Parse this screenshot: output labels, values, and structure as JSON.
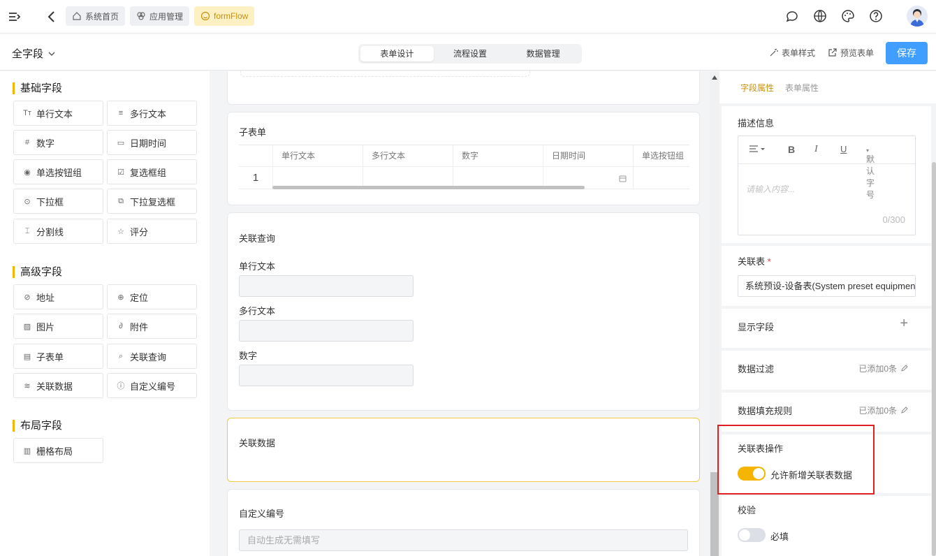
{
  "topbar": {
    "tabs": [
      {
        "label": "系统首页",
        "icon": "home-icon"
      },
      {
        "label": "应用管理",
        "icon": "apps-icon"
      },
      {
        "label": "formFlow",
        "icon": "smile-icon"
      }
    ],
    "icons": [
      "chat-icon",
      "globe-icon",
      "palette-icon",
      "help-icon"
    ]
  },
  "subbar": {
    "form_name": "全字段",
    "segments": [
      "表单设计",
      "流程设置",
      "数据管理"
    ],
    "active_segment": "表单设计",
    "form_style": "表单样式",
    "preview": "预览表单",
    "save": "保存"
  },
  "left": {
    "groups": [
      {
        "title": "基础字段",
        "items": [
          {
            "label": "单行文本",
            "icon": "Tт"
          },
          {
            "label": "多行文本",
            "icon": "≡"
          },
          {
            "label": "数字",
            "icon": "#"
          },
          {
            "label": "日期时间",
            "icon": "▭"
          },
          {
            "label": "单选按钮组",
            "icon": "◉"
          },
          {
            "label": "复选框组",
            "icon": "☑"
          },
          {
            "label": "下拉框",
            "icon": "⊙"
          },
          {
            "label": "下拉复选框",
            "icon": "⧉"
          },
          {
            "label": "分割线",
            "icon": "⌶"
          },
          {
            "label": "评分",
            "icon": "☆"
          }
        ]
      },
      {
        "title": "高级字段",
        "items": [
          {
            "label": "地址",
            "icon": "⊘"
          },
          {
            "label": "定位",
            "icon": "⊕"
          },
          {
            "label": "图片",
            "icon": "▨"
          },
          {
            "label": "附件",
            "icon": "∂"
          },
          {
            "label": "子表单",
            "icon": "▤"
          },
          {
            "label": "关联查询",
            "icon": "⌕"
          },
          {
            "label": "关联数据",
            "icon": "≋"
          },
          {
            "label": "自定义编号",
            "icon": "ⓘ"
          }
        ]
      },
      {
        "title": "布局字段",
        "items": [
          {
            "label": "栅格布局",
            "icon": "▥"
          }
        ]
      }
    ]
  },
  "canvas": {
    "subform": {
      "title": "子表单",
      "columns": [
        "单行文本",
        "多行文本",
        "数字",
        "日期时间",
        "单选按钮组"
      ],
      "row_number": "1"
    },
    "lookup": {
      "title": "关联查询",
      "fields": [
        "单行文本",
        "多行文本",
        "数字"
      ]
    },
    "related_data": {
      "title": "关联数据"
    },
    "custom_number": {
      "title": "自定义编号",
      "placeholder": "自动生成无需填写"
    }
  },
  "right": {
    "tabs": [
      "字段属性",
      "表单属性"
    ],
    "active_tab": "字段属性",
    "description": {
      "title": "描述信息",
      "font_size_label": "默认字号",
      "placeholder": "请输入内容...",
      "counter": "0/300"
    },
    "related_table": {
      "title": "关联表",
      "required_mark": "*",
      "value": "系统预设-设备表(System preset equipment)"
    },
    "display_fields": {
      "title": "显示字段",
      "add": "+"
    },
    "data_filter": {
      "title": "数据过滤",
      "value": "已添加0条"
    },
    "fill_rules": {
      "title": "数据填充规则",
      "value": "已添加0条"
    },
    "related_ops": {
      "title": "关联表操作",
      "toggle_label": "允许新增关联表数据",
      "toggle_on": true
    },
    "validation": {
      "title": "校验",
      "toggle_label": "必填",
      "toggle_on": false
    },
    "accent_color": "#f5b400",
    "primary_color": "#409eff"
  }
}
